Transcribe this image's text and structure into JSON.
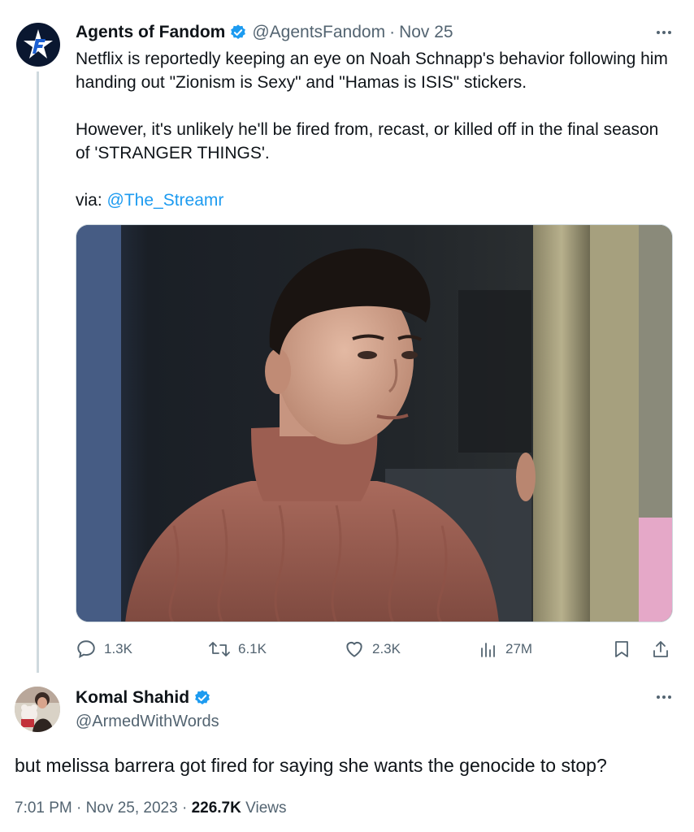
{
  "tweet": {
    "author": {
      "display_name": "Agents of Fandom",
      "handle": "@AgentsFandom",
      "verified": true,
      "avatar_icon": "agents-of-fandom-logo"
    },
    "separator": "·",
    "date": "Nov 25",
    "paragraphs": [
      "Netflix is reportedly keeping an eye on Noah Schnapp's behavior following him handing out \"Zionism is Sexy\" and \"Hamas is ISIS\" stickers.",
      "However, it's unlikely he'll be fired from, recast, or killed off in the final season of 'STRANGER THINGS'."
    ],
    "via_label": "via: ",
    "via_link": "@The_Streamr",
    "media": {
      "kind": "photo"
    },
    "stats": {
      "replies": "1.3K",
      "reposts": "6.1K",
      "likes": "2.3K",
      "views": "27M"
    }
  },
  "reply": {
    "author": {
      "display_name": "Komal Shahid",
      "handle": "@ArmedWithWords",
      "verified": true
    },
    "text": "but melissa barrera got fired for saying she wants the genocide to stop?",
    "time": "7:01 PM",
    "separator": "·",
    "date": "Nov 25, 2023",
    "views_count": "226.7K",
    "views_label": "Views"
  },
  "colors": {
    "text": "#0f1419",
    "secondary": "#536471",
    "link": "#1d9bf0",
    "verified_badge": "#1d9bf0",
    "thread_line": "#cfd9de"
  }
}
